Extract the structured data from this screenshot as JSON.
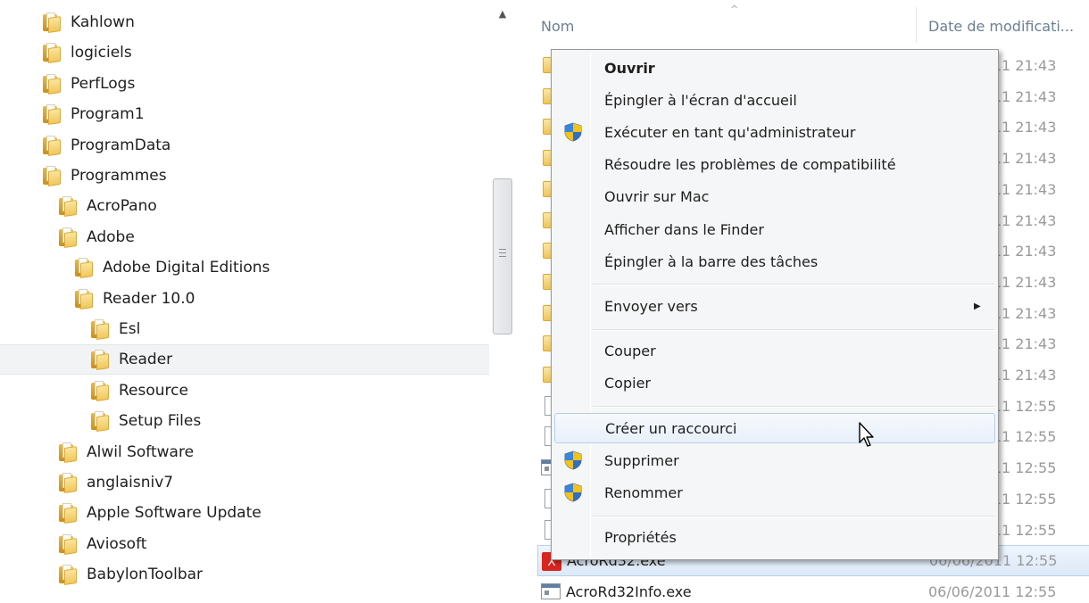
{
  "tree": {
    "items": [
      {
        "label": "Kahlown",
        "level": 0
      },
      {
        "label": "logiciels",
        "level": 0
      },
      {
        "label": "PerfLogs",
        "level": 0
      },
      {
        "label": "Program1",
        "level": 0
      },
      {
        "label": "ProgramData",
        "level": 0
      },
      {
        "label": "Programmes",
        "level": 0
      },
      {
        "label": "AcroPano",
        "level": 1
      },
      {
        "label": "Adobe",
        "level": 1
      },
      {
        "label": "Adobe Digital Editions",
        "level": 2
      },
      {
        "label": "Reader 10.0",
        "level": 2
      },
      {
        "label": "Esl",
        "level": 3
      },
      {
        "label": "Reader",
        "level": 3,
        "selected": true
      },
      {
        "label": "Resource",
        "level": 3
      },
      {
        "label": "Setup Files",
        "level": 3
      },
      {
        "label": "Alwil Software",
        "level": 1
      },
      {
        "label": "anglaisniv7",
        "level": 1
      },
      {
        "label": "Apple Software Update",
        "level": 1
      },
      {
        "label": "Aviosoft",
        "level": 1
      },
      {
        "label": "BabylonToolbar",
        "level": 1
      }
    ]
  },
  "file_list": {
    "headers": {
      "name": "Nom",
      "date": "Date de modificati..."
    },
    "rows": [
      {
        "icon": "folder-icon",
        "name": "",
        "date": "06/06/2011 21:43"
      },
      {
        "icon": "folder-icon",
        "name": "",
        "date": "06/06/2011 21:43"
      },
      {
        "icon": "folder-icon",
        "name": "",
        "date": "06/06/2011 21:43"
      },
      {
        "icon": "folder-icon",
        "name": "",
        "date": "06/06/2011 21:43"
      },
      {
        "icon": "folder-icon",
        "name": "",
        "date": "06/06/2011 21:43"
      },
      {
        "icon": "folder-icon",
        "name": "",
        "date": "06/06/2011 21:43"
      },
      {
        "icon": "folder-icon",
        "name": "",
        "date": "06/06/2011 21:43"
      },
      {
        "icon": "folder-icon",
        "name": "",
        "date": "06/06/2011 21:43"
      },
      {
        "icon": "folder-icon",
        "name": "",
        "date": "06/06/2011 21:43"
      },
      {
        "icon": "folder-icon",
        "name": "",
        "date": "06/06/2011 21:43"
      },
      {
        "icon": "folder-icon",
        "name": "",
        "date": "06/06/2011 21:43"
      },
      {
        "icon": "document-icon",
        "name": "",
        "date": "06/06/2011 12:55"
      },
      {
        "icon": "document-icon",
        "name": "",
        "date": "06/06/2011 12:55"
      },
      {
        "icon": "exe-icon",
        "name": "",
        "date": "06/06/2011 12:55"
      },
      {
        "icon": "document-icon",
        "name": "",
        "date": "06/06/2011 12:55"
      },
      {
        "icon": "document-icon",
        "name": "",
        "date": "06/06/2011 12:55"
      },
      {
        "icon": "pdf-icon",
        "name": "AcroRd32.exe",
        "date": "06/06/2011 12:55",
        "highlighted": true
      },
      {
        "icon": "exe-icon",
        "name": "AcroRd32Info.exe",
        "date": "06/06/2011 12:55"
      }
    ]
  },
  "context_menu": {
    "items": [
      {
        "label": "Ouvrir",
        "bold": true
      },
      {
        "label": "Épingler à l'écran d'accueil"
      },
      {
        "label": "Exécuter en tant qu'administrateur",
        "icon": "uac-shield-icon"
      },
      {
        "label": "Résoudre les problèmes de compatibilité"
      },
      {
        "label": "Ouvrir sur Mac"
      },
      {
        "label": "Afficher dans le Finder"
      },
      {
        "label": "Épingler à la barre des tâches"
      },
      {
        "separator": true
      },
      {
        "label": "Envoyer vers",
        "submenu": true
      },
      {
        "separator": true
      },
      {
        "label": "Couper"
      },
      {
        "label": "Copier"
      },
      {
        "separator": true
      },
      {
        "label": "Créer un raccourci",
        "hover": true
      },
      {
        "label": "Supprimer",
        "icon": "uac-shield-icon"
      },
      {
        "label": "Renommer",
        "icon": "uac-shield-icon"
      },
      {
        "separator": true
      },
      {
        "label": "Propriétés"
      }
    ]
  },
  "colors": {
    "menu_background": "#f5f6f7",
    "hover_highlight": "#e8f0fa",
    "header_text": "#6b7f93",
    "date_text": "#9a9a9a"
  }
}
